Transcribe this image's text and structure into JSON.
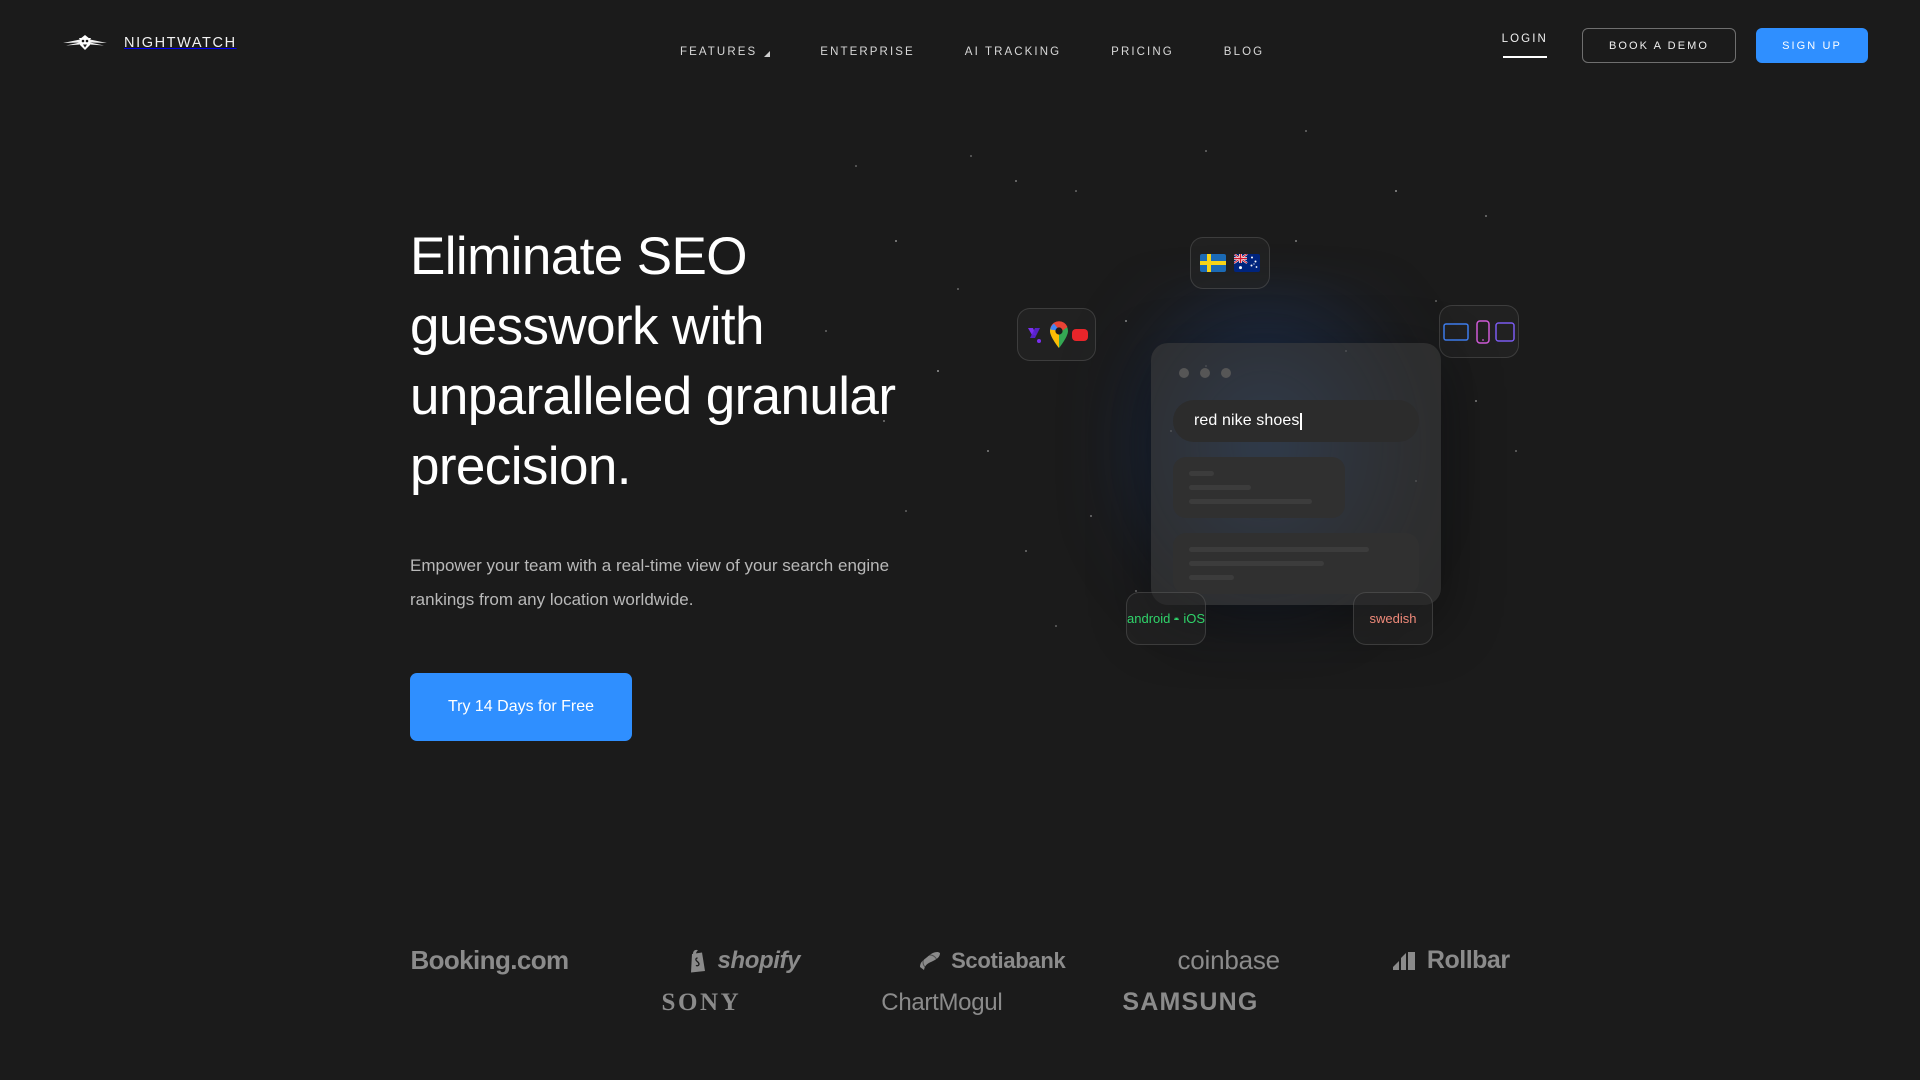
{
  "brand": {
    "name": "NIGHTWATCH",
    "logo_icon": "owl-wings-logo"
  },
  "nav": {
    "items": [
      {
        "label": "FEATURES",
        "has_dropdown": true
      },
      {
        "label": "ENTERPRISE",
        "has_dropdown": false
      },
      {
        "label": "AI TRACKING",
        "has_dropdown": false
      },
      {
        "label": "PRICING",
        "has_dropdown": false
      },
      {
        "label": "BLOG",
        "has_dropdown": false
      }
    ]
  },
  "actions": {
    "login": "LOGIN",
    "book_demo": "BOOK A DEMO",
    "sign_up": "SIGN UP"
  },
  "hero": {
    "headline": "Eliminate SEO guesswork with unparalleled granular precision.",
    "subhead": "Empower your team with a real-time view of your search engine rankings from any location worldwide.",
    "cta": "Try 14 Days for Free"
  },
  "art": {
    "search_query": "red nike shoes",
    "flags": [
      "sweden-flag",
      "australia-flag"
    ],
    "engines": [
      "yahoo-icon",
      "google-maps-pin-icon",
      "youtube-icon"
    ],
    "devices": [
      "desktop-icon",
      "mobile-icon",
      "tablet-icon"
    ],
    "android_label": "android",
    "ios_label": "iOS",
    "language_label": "swedish"
  },
  "logos": {
    "row1": [
      "Booking.com",
      "shopify",
      "Scotiabank",
      "coinbase",
      "Rollbar"
    ],
    "row2": [
      "SONY",
      "ChartMogul",
      "SAMSUNG"
    ]
  },
  "colors": {
    "background": "#1b1b1b",
    "accent_blue": "#2f8fff",
    "text_primary": "#ffffff",
    "text_muted": "#b9b9b9",
    "android_green": "#2fd46a",
    "swedish_salmon": "#f08a7a"
  }
}
